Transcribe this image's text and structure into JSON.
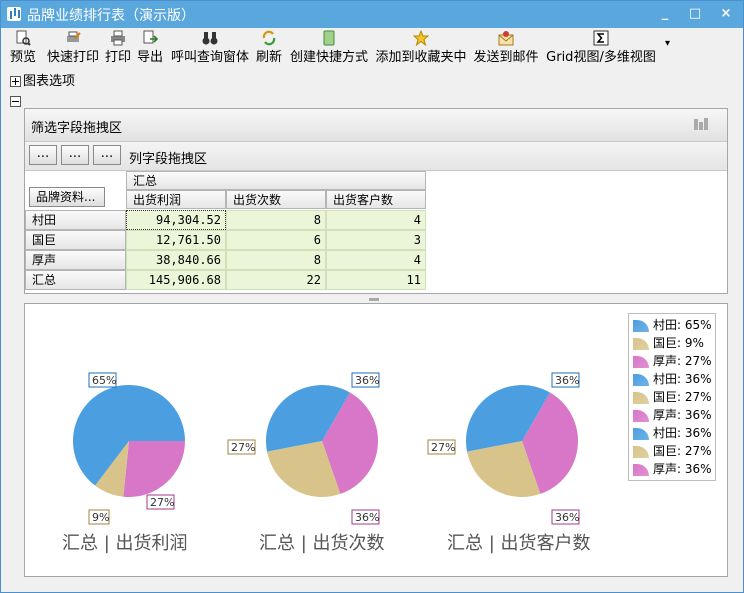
{
  "window": {
    "title": "品牌业绩排行表（演示版）",
    "min": "_",
    "max": "□",
    "close": "×"
  },
  "toolbar": {
    "items": [
      {
        "label": "预览",
        "icon": "preview-icon"
      },
      {
        "label": "快速打印",
        "icon": "quick-print-icon"
      },
      {
        "label": "打印",
        "icon": "print-icon"
      },
      {
        "label": "导出",
        "icon": "export-icon"
      },
      {
        "label": "呼叫查询窗体",
        "icon": "binoculars-icon"
      },
      {
        "label": "刷新",
        "icon": "refresh-icon"
      },
      {
        "label": "创建快捷方式",
        "icon": "shortcut-icon"
      },
      {
        "label": "添加到收藏夹中",
        "icon": "star-icon"
      },
      {
        "label": "发送到邮件",
        "icon": "mail-icon"
      },
      {
        "label": "Grid视图/多维视图",
        "icon": "sigma-icon"
      }
    ],
    "overflow": "▾"
  },
  "chart_options": {
    "label": "图表选项"
  },
  "pivot": {
    "filter_area_label": "筛选字段拖拽区",
    "column_area_label": "列字段拖拽区",
    "dot_buttons": [
      "...",
      "...",
      "..."
    ],
    "row_field_button": "品牌资料...",
    "group_header": "汇总",
    "columns": [
      "出货利润",
      "出货次数",
      "出货客户数"
    ],
    "rows": [
      {
        "brand": "村田",
        "values": [
          "94,304.52",
          "8",
          "4"
        ]
      },
      {
        "brand": "国巨",
        "values": [
          "12,761.50",
          "6",
          "3"
        ]
      },
      {
        "brand": "厚声",
        "values": [
          "38,840.66",
          "8",
          "4"
        ]
      },
      {
        "brand": "汇总",
        "values": [
          "145,906.68",
          "22",
          "11"
        ]
      }
    ]
  },
  "legend": [
    {
      "label": "村田: 65%",
      "color": "#4b9fe1"
    },
    {
      "label": "国巨: 9%",
      "color": "#d8c48a"
    },
    {
      "label": "厚声: 27%",
      "color": "#d876c8"
    },
    {
      "label": "村田: 36%",
      "color": "#4b9fe1"
    },
    {
      "label": "国巨: 27%",
      "color": "#d8c48a"
    },
    {
      "label": "厚声: 36%",
      "color": "#d876c8"
    },
    {
      "label": "村田: 36%",
      "color": "#4b9fe1"
    },
    {
      "label": "国巨: 27%",
      "color": "#d8c48a"
    },
    {
      "label": "厚声: 36%",
      "color": "#d876c8"
    }
  ],
  "chart_data": [
    {
      "type": "pie",
      "title": "汇总 | 出货利润",
      "categories": [
        "村田",
        "国巨",
        "厚声"
      ],
      "values": [
        94304.52,
        12761.5,
        38840.66
      ],
      "labels": [
        "65%",
        "9%",
        "27%"
      ]
    },
    {
      "type": "pie",
      "title": "汇总 | 出货次数",
      "categories": [
        "村田",
        "国巨",
        "厚声"
      ],
      "values": [
        8,
        6,
        8
      ],
      "labels": [
        "36%",
        "27%",
        "36%"
      ]
    },
    {
      "type": "pie",
      "title": "汇总 | 出货客户数",
      "categories": [
        "村田",
        "国巨",
        "厚声"
      ],
      "values": [
        4,
        3,
        4
      ],
      "labels": [
        "36%",
        "27%",
        "36%"
      ]
    }
  ],
  "colors": {
    "series": [
      "#4b9fe1",
      "#d8c48a",
      "#d876c8"
    ],
    "label_borders": [
      "#1f6fb5",
      "#9c8640",
      "#a03a8e"
    ]
  }
}
